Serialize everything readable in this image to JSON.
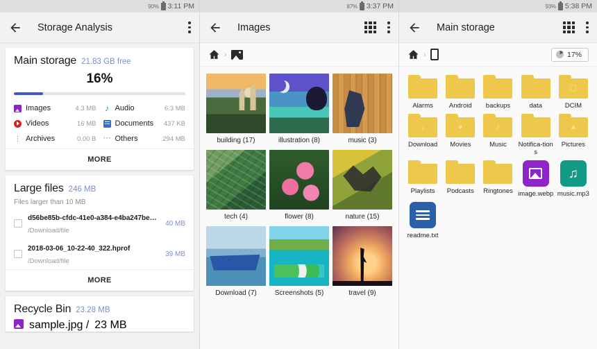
{
  "panel1": {
    "status": {
      "battery_pct": "90%",
      "time": "3:11 PM"
    },
    "appbar": {
      "title": "Storage Analysis",
      "back_icon": "arrow-back-icon",
      "overflow_icon": "more-vert-icon"
    },
    "storage_card": {
      "title": "Main storage",
      "free": "21.83 GB free",
      "used_pct_label": "16%",
      "used_fraction": 17,
      "bar_color": "#4356c8",
      "categories": [
        {
          "icon": "images-icon",
          "name": "Images",
          "size": "4.3 MB",
          "color": "#8e24c9"
        },
        {
          "icon": "audio-icon",
          "name": "Audio",
          "size": "6.3 MB",
          "color": "#19a08a"
        },
        {
          "icon": "videos-icon",
          "name": "Videos",
          "size": "16 MB",
          "color": "#d32020"
        },
        {
          "icon": "documents-icon",
          "name": "Documents",
          "size": "437 KB",
          "color": "#2f6fd0"
        },
        {
          "icon": "archives-icon",
          "name": "Archives",
          "size": "0.00 B",
          "color": "#6d6d6d"
        },
        {
          "icon": "others-icon",
          "name": "Others",
          "size": "294 MB",
          "color": "#8d8d8d"
        }
      ],
      "more_label": "MORE"
    },
    "large_files_card": {
      "title": "Large files",
      "total": "246 MB",
      "hint": "Files larger than 10 MB",
      "files": [
        {
          "name": "d56be85b-cfdc-41e0-a384-e4ba247be…",
          "path": "/Download/file",
          "size": "40 MB"
        },
        {
          "name": "2018-03-06_10-22-40_322.hprof",
          "path": "/Download/file",
          "size": "39 MB"
        }
      ],
      "more_label": "MORE"
    },
    "recycle_bin_card": {
      "title": "Recycle Bin",
      "total": "23.28 MB",
      "files": [
        {
          "name": "sample.jpg",
          "path": "/",
          "size": "23 MB"
        }
      ]
    }
  },
  "panel2": {
    "status": {
      "battery_pct": "87%",
      "time": "3:37 PM"
    },
    "appbar": {
      "title": "Images",
      "back_icon": "arrow-back-icon",
      "grid_icon": "grid-view-icon",
      "overflow_icon": "more-vert-icon"
    },
    "breadcrumb": [
      {
        "icon": "home-icon",
        "label": ""
      },
      {
        "icon": "images-icon",
        "label": ""
      }
    ],
    "albums": [
      {
        "label": "building (17)",
        "thumb": "th-building"
      },
      {
        "label": "illustration (8)",
        "thumb": "th-illus"
      },
      {
        "label": "music (3)",
        "thumb": "th-music"
      },
      {
        "label": "tech (4)",
        "thumb": "th-tech"
      },
      {
        "label": "flower (8)",
        "thumb": "th-flower"
      },
      {
        "label": "nature (15)",
        "thumb": "th-nature"
      },
      {
        "label": "Download (7)",
        "thumb": "th-download"
      },
      {
        "label": "Screenshots (5)",
        "thumb": "th-screens"
      },
      {
        "label": "travel (9)",
        "thumb": "th-travel"
      }
    ]
  },
  "panel3": {
    "status": {
      "battery_pct": "93%",
      "time": "5:38 PM"
    },
    "appbar": {
      "title": "Main storage",
      "back_icon": "arrow-back-icon",
      "grid_icon": "grid-view-icon",
      "overflow_icon": "more-vert-icon"
    },
    "breadcrumb": [
      {
        "icon": "home-icon",
        "label": ""
      },
      {
        "icon": "phone-icon",
        "label": ""
      }
    ],
    "storage_chip": {
      "label": "17%",
      "fraction": 17,
      "icon": "pie-chart-icon"
    },
    "items": [
      {
        "name": "Alarms",
        "type": "folder",
        "badge": ""
      },
      {
        "name": "Android",
        "type": "folder",
        "badge": ""
      },
      {
        "name": "backups",
        "type": "folder",
        "badge": ""
      },
      {
        "name": "data",
        "type": "folder",
        "badge": ""
      },
      {
        "name": "DCIM",
        "type": "folder",
        "badge": "camera-icon"
      },
      {
        "name": "Download",
        "type": "folder",
        "badge": "download-icon"
      },
      {
        "name": "Movies",
        "type": "folder",
        "badge": "movie-icon"
      },
      {
        "name": "Music",
        "type": "folder",
        "badge": "music-note-icon"
      },
      {
        "name": "Notifica-tions",
        "type": "folder",
        "badge": ""
      },
      {
        "name": "Pictures",
        "type": "folder",
        "badge": "picture-icon"
      },
      {
        "name": "Playlists",
        "type": "folder",
        "badge": ""
      },
      {
        "name": "Podcasts",
        "type": "folder",
        "badge": ""
      },
      {
        "name": "Ringtones",
        "type": "folder",
        "badge": ""
      },
      {
        "name": "image.webp",
        "type": "image-file",
        "color": "#8e24c9"
      },
      {
        "name": "music.mp3",
        "type": "audio-file",
        "color": "#129b87"
      },
      {
        "name": "readme.txt",
        "type": "text-file",
        "color": "#2b5fa8"
      }
    ]
  }
}
